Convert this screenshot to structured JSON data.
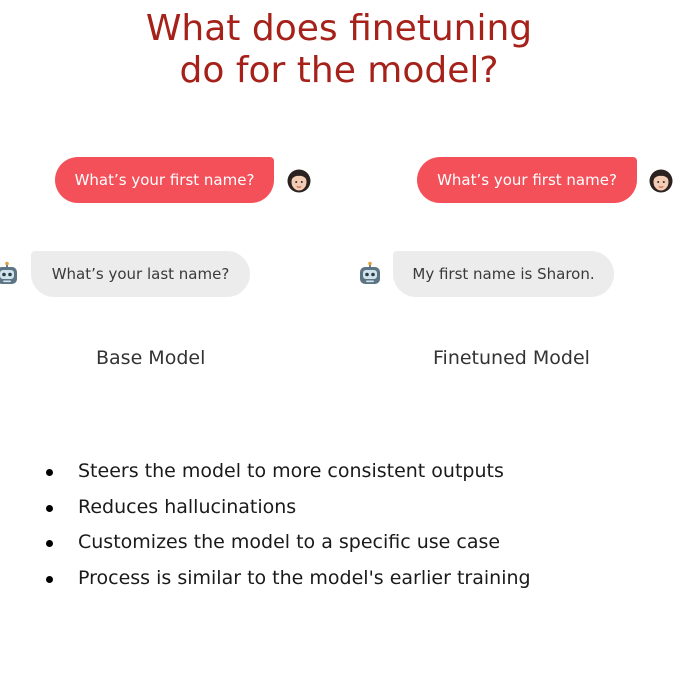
{
  "title": {
    "line1": "What does finetuning",
    "line2": "do for the model?"
  },
  "base_model": {
    "user_message": "What’s your first name?",
    "bot_message": "What’s your last name?",
    "label": "Base Model"
  },
  "finetuned_model": {
    "user_message": "What’s your first name?",
    "bot_message": "My first name is Sharon.",
    "label": "Finetuned Model"
  },
  "bullets": [
    "Steers the model to more consistent outputs",
    "Reduces hallucinations",
    "Customizes the model to a specific use case",
    "Process is similar to the model's earlier training"
  ],
  "colors": {
    "title": "#a5211a",
    "user_bubble": "#f4505a",
    "bot_bubble": "#ececec"
  },
  "icons": {
    "user_avatar": "woman-face-icon",
    "bot_avatar": "robot-face-icon"
  }
}
